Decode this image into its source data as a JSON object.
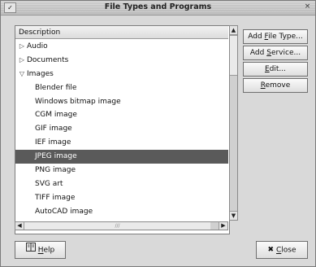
{
  "window": {
    "title": "File Types and Programs",
    "menu_glyph": "✓",
    "close_glyph": "×"
  },
  "list": {
    "header": "Description",
    "rows": [
      {
        "label": "Audio",
        "expander": "▷",
        "level": 0
      },
      {
        "label": "Documents",
        "expander": "▷",
        "level": 0
      },
      {
        "label": "Images",
        "expander": "▽",
        "level": 0
      },
      {
        "label": "Blender file",
        "expander": "",
        "level": 1
      },
      {
        "label": "Windows bitmap image",
        "expander": "",
        "level": 1
      },
      {
        "label": "CGM image",
        "expander": "",
        "level": 1
      },
      {
        "label": "GIF image",
        "expander": "",
        "level": 1
      },
      {
        "label": "IEF image",
        "expander": "",
        "level": 1
      },
      {
        "label": "JPEG image",
        "expander": "",
        "level": 1,
        "selected": true
      },
      {
        "label": "PNG image",
        "expander": "",
        "level": 1
      },
      {
        "label": "SVG art",
        "expander": "",
        "level": 1
      },
      {
        "label": "TIFF image",
        "expander": "",
        "level": 1
      },
      {
        "label": "AutoCAD image",
        "expander": "",
        "level": 1
      }
    ]
  },
  "buttons": {
    "add_file_type": {
      "pre": "Add ",
      "u": "F",
      "post": "ile Type..."
    },
    "add_service": {
      "pre": "Add ",
      "u": "S",
      "post": "ervice..."
    },
    "edit": {
      "pre": "",
      "u": "E",
      "post": "dit..."
    },
    "remove": {
      "pre": "",
      "u": "R",
      "post": "emove"
    },
    "help": {
      "pre": "",
      "u": "H",
      "post": "elp"
    },
    "close": {
      "pre": "",
      "u": "C",
      "post": "lose"
    }
  },
  "icons": {
    "help": "help-book-icon",
    "close": "x-icon"
  },
  "colors": {
    "selection": "#5a5a5a",
    "window_bg": "#d9d9d9"
  }
}
